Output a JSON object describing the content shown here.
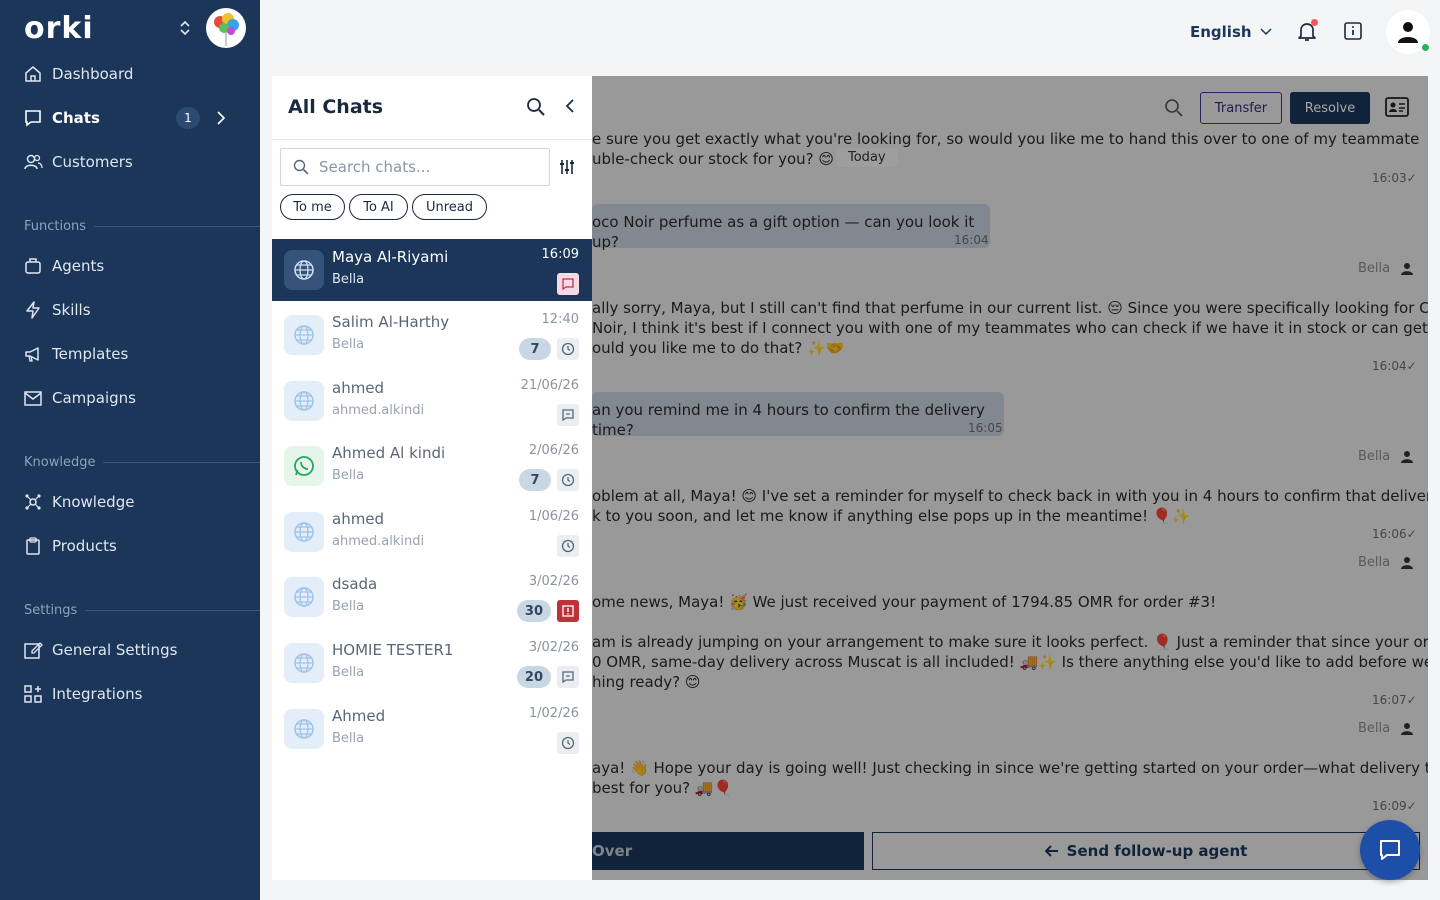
{
  "app": {
    "logo": "orki"
  },
  "sidebar": {
    "items": [
      {
        "label": "Dashboard"
      },
      {
        "label": "Chats",
        "badge": "1"
      },
      {
        "label": "Customers"
      },
      {
        "label": "Agents"
      },
      {
        "label": "Skills"
      },
      {
        "label": "Templates"
      },
      {
        "label": "Campaigns"
      },
      {
        "label": "Knowledge"
      },
      {
        "label": "Products"
      },
      {
        "label": "General Settings"
      },
      {
        "label": "Integrations"
      }
    ],
    "sections": [
      "Functions",
      "Knowledge",
      "Settings"
    ]
  },
  "topbar": {
    "language": "English"
  },
  "chatlist": {
    "title": "All Chats",
    "search_placeholder": "Search chats...",
    "filters": [
      "To me",
      "To AI",
      "Unread"
    ],
    "rows": [
      {
        "name": "Maya Al-Riyami",
        "sub": "Bella",
        "time": "16:09",
        "count": "",
        "status": "chat-icon",
        "channel": "globe-icon",
        "selected": true
      },
      {
        "name": "Salim Al-Harthy",
        "sub": "Bella",
        "time": "12:40",
        "count": "7",
        "status": "clock-icon",
        "channel": "globe-icon"
      },
      {
        "name": "ahmed",
        "sub": "ahmed.alkindi",
        "time": "21/06/26",
        "count": "",
        "status": "chat-icon",
        "channel": "globe-icon"
      },
      {
        "name": "Ahmed Al kindi",
        "sub": "Bella",
        "time": "2/06/26",
        "count": "7",
        "status": "clock-icon",
        "channel": "whatsapp-icon"
      },
      {
        "name": "ahmed",
        "sub": "ahmed.alkindi",
        "time": "1/06/26",
        "count": "",
        "status": "clock-icon",
        "channel": "globe-icon"
      },
      {
        "name": "dsada",
        "sub": "Bella",
        "time": "3/02/26",
        "count": "30",
        "status": "alert-icon",
        "channel": "globe-icon"
      },
      {
        "name": "HOMIE TESTER1",
        "sub": "Bella",
        "time": "3/02/26",
        "count": "20",
        "status": "chat-icon",
        "channel": "globe-icon"
      },
      {
        "name": "Ahmed",
        "sub": "Bella",
        "time": "1/02/26",
        "count": "",
        "status": "clock-icon",
        "channel": "globe-icon"
      }
    ]
  },
  "conversation": {
    "transfer_label": "Transfer",
    "resolve_label": "Resolve",
    "today_label": "Today",
    "messages": [
      {
        "line1": "e sure you get exactly what you're looking for, so would you like me to hand this over to one of my teammates who",
        "line2": "uble-check our stock for you? 😊✨",
        "time": "16:03✓"
      },
      {
        "line1": "oco Noir perfume as a gift option — can you look it up?",
        "time": "16:04"
      },
      {
        "sender": "Bella"
      },
      {
        "line1": "ally sorry, Maya, but I still can't find that perfume in our current list. 😔 Since you were specifically looking for Chanel",
        "line2": "Noir, I think it's best if I connect you with one of my teammates who can check if we have it in stock or can get it for",
        "line3": "ould you like me to do that? ✨🤝",
        "time": "16:04✓"
      },
      {
        "line1": "an you remind me in 4 hours to confirm the delivery time?",
        "time": "16:05"
      },
      {
        "sender": "Bella"
      },
      {
        "line1": "oblem at all, Maya! 😊 I've set a reminder for myself to check back in with you in 4 hours to confirm that delivery time.",
        "line2": "k to you soon, and let me know if anything else pops up in the meantime! 🎈✨",
        "time": "16:06✓"
      },
      {
        "sender": "Bella"
      },
      {
        "line1": "ome news, Maya! 🥳 We just received your payment of 1794.85 OMR for order #3!",
        "line2": "am is already jumping on your arrangement to make sure it looks perfect. 🎈 Just a reminder that since your order is",
        "line3": "0 OMR, same-day delivery across Muscat is all included! 🚚✨ Is there anything else you'd like to add before we get",
        "line4": "hing ready? 😊",
        "time": "16:07✓"
      },
      {
        "sender": "Bella"
      },
      {
        "line1": "aya! 👋 Hope your day is going well! Just checking in since we're getting started on your order—what delivery time",
        "line2": "best for you? 🚚🎈",
        "time": "16:09✓"
      }
    ],
    "handover_label": "Over",
    "followup_label": "Send follow-up agent"
  }
}
